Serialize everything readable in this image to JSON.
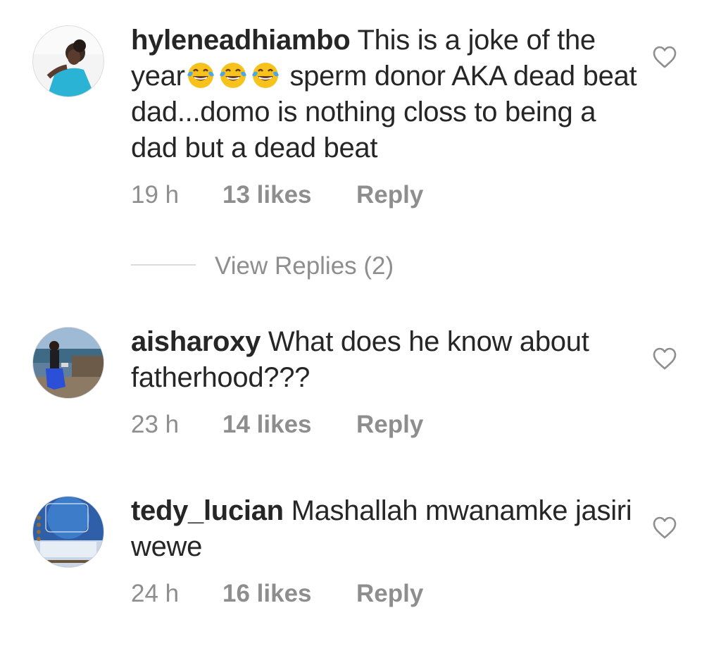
{
  "comments": [
    {
      "username": "hyleneadhiambo",
      "text_before_emoji": " This is a joke of the year",
      "emojis": [
        "face-with-tears-of-joy",
        "face-with-tears-of-joy",
        "face-with-tears-of-joy"
      ],
      "text_after_emoji": " sperm donor AKA dead beat dad...domo is nothing closs to being a dad but a dead beat",
      "time": "19 h",
      "likes": "13 likes",
      "reply": "Reply",
      "view_replies": "View Replies (2)"
    },
    {
      "username": "aisharoxy",
      "text": " What does he know about fatherhood???",
      "time": "23 h",
      "likes": "14 likes",
      "reply": "Reply"
    },
    {
      "username": "tedy_lucian",
      "text": " Mashallah mwanamke jasiri wewe",
      "time": "24 h",
      "likes": "16 likes",
      "reply": "Reply"
    }
  ],
  "icons": {
    "like": "heart-outline-icon",
    "emoji": "face-with-tears-of-joy"
  },
  "colors": {
    "text": "#262626",
    "meta": "#8e8e8e",
    "divider": "#dbdbdb",
    "heart": "#8e8e8e"
  }
}
